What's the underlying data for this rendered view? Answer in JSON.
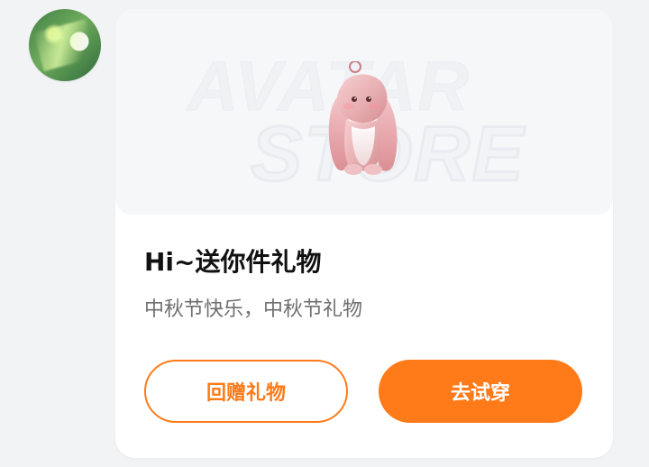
{
  "user": {
    "avatar_icon": "user-avatar-icon"
  },
  "gift_card": {
    "banner": {
      "brand_watermark_line1": "AVATAR",
      "brand_watermark_line2": "STORE",
      "item_icon": "bunny-plush-icon"
    },
    "title": "Hi~送你件礼物",
    "message": "中秋节快乐，中秋节礼物",
    "actions": {
      "return_gift_label": "回赠礼物",
      "try_on_label": "去试穿"
    }
  },
  "colors": {
    "accent": "#ff7a18",
    "page_bg": "#f2f3f5",
    "card_bg": "#ffffff",
    "banner_bg": "#f6f7f9",
    "title_text": "#111111",
    "secondary_text": "#6f6f6f"
  }
}
